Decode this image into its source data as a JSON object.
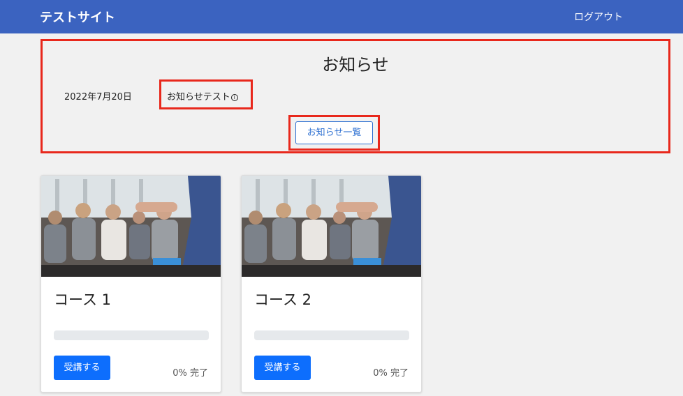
{
  "navbar": {
    "brand": "テストサイト",
    "logout": "ログアウト"
  },
  "notice": {
    "title": "お知らせ",
    "date": "2022年7月20日",
    "item": "お知らせテスト",
    "item_icon": "info-circle-icon",
    "list_button": "お知らせ一覧"
  },
  "colors": {
    "navbar": "#3b63c0",
    "highlight": "#e8281c",
    "primary": "#0d6efd"
  },
  "courses": [
    {
      "title": "コース 1",
      "progress": 0,
      "progress_label": "0% 完了",
      "button": "受講する",
      "image": "seminar-audience-photo"
    },
    {
      "title": "コース 2",
      "progress": 0,
      "progress_label": "0% 完了",
      "button": "受講する",
      "image": "seminar-audience-photo"
    }
  ]
}
